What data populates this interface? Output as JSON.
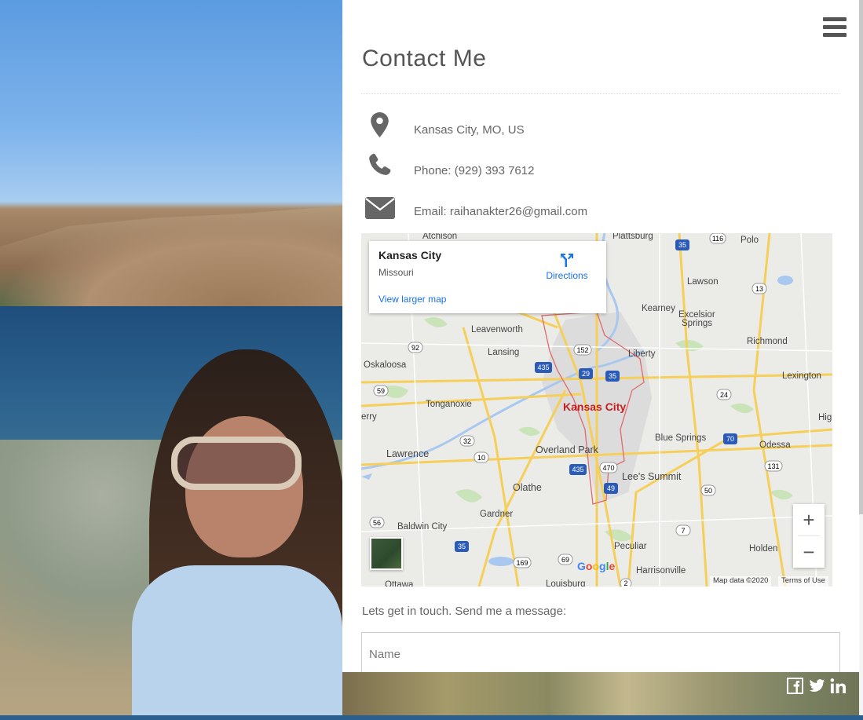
{
  "page": {
    "title": "Contact Me",
    "contact": {
      "location": "Kansas City, MO, US",
      "phone": "Phone: (929) 393 7612",
      "email": "Email: raihanakter26@gmail.com"
    },
    "cta": "Lets get in touch. Send me a message:",
    "form": {
      "name_placeholder": "Name"
    }
  },
  "map": {
    "card": {
      "place": "Kansas City",
      "region": "Missouri",
      "directions": "Directions",
      "larger_map": "View larger map"
    },
    "zoom_in": "+",
    "zoom_out": "−",
    "logo": "Google",
    "data_credit": "Map data ©2020",
    "terms": "Terms of Use",
    "labels": {
      "atchison": "Atchison",
      "plattsburg": "Plattsburg",
      "polo": "Polo",
      "lawson": "Lawson",
      "kearney": "Kearney",
      "excelsior1": "Excelsior",
      "excelsior2": "Springs",
      "leavenworth": "Leavenworth",
      "lansing": "Lansing",
      "richmond": "Richmond",
      "liberty": "Liberty",
      "oskaloosa": "Oskaloosa",
      "lexington": "Lexington",
      "tonganoxie": "Tonganoxie",
      "kansas_city": "Kansas City",
      "blue_springs": "Blue Springs",
      "odessa": "Odessa",
      "lawrence": "Lawrence",
      "overland_park": "Overland Park",
      "lees_summit": "Lee's Summit",
      "olathe": "Olathe",
      "gardner": "Gardner",
      "baldwin_city": "Baldwin City",
      "peculiar": "Peculiar",
      "holden": "Holden",
      "harrisonville": "Harrisonville",
      "ottawa": "Ottawa",
      "louisburg": "Louisburg",
      "erry": "erry",
      "hig": "Hig",
      "r116": "116",
      "r35a": "35",
      "r13": "13",
      "r152": "152",
      "r92": "92",
      "r435a": "435",
      "r29": "29",
      "r35b": "35",
      "r24": "24",
      "r59": "59",
      "r32": "32",
      "r10": "10",
      "r70": "70",
      "r435b": "435",
      "r470": "470",
      "r49": "49",
      "r131": "131",
      "r50": "50",
      "r56": "56",
      "r7": "7",
      "r35c": "35",
      "r169": "169",
      "r69": "69",
      "r2": "2"
    }
  },
  "social": {
    "facebook": "facebook-icon",
    "twitter": "twitter-icon",
    "linkedin": "linkedin-icon"
  },
  "colors": {
    "accent_link": "#1a73e8",
    "city_red": "#c5221f",
    "heading_gray": "#555555"
  }
}
